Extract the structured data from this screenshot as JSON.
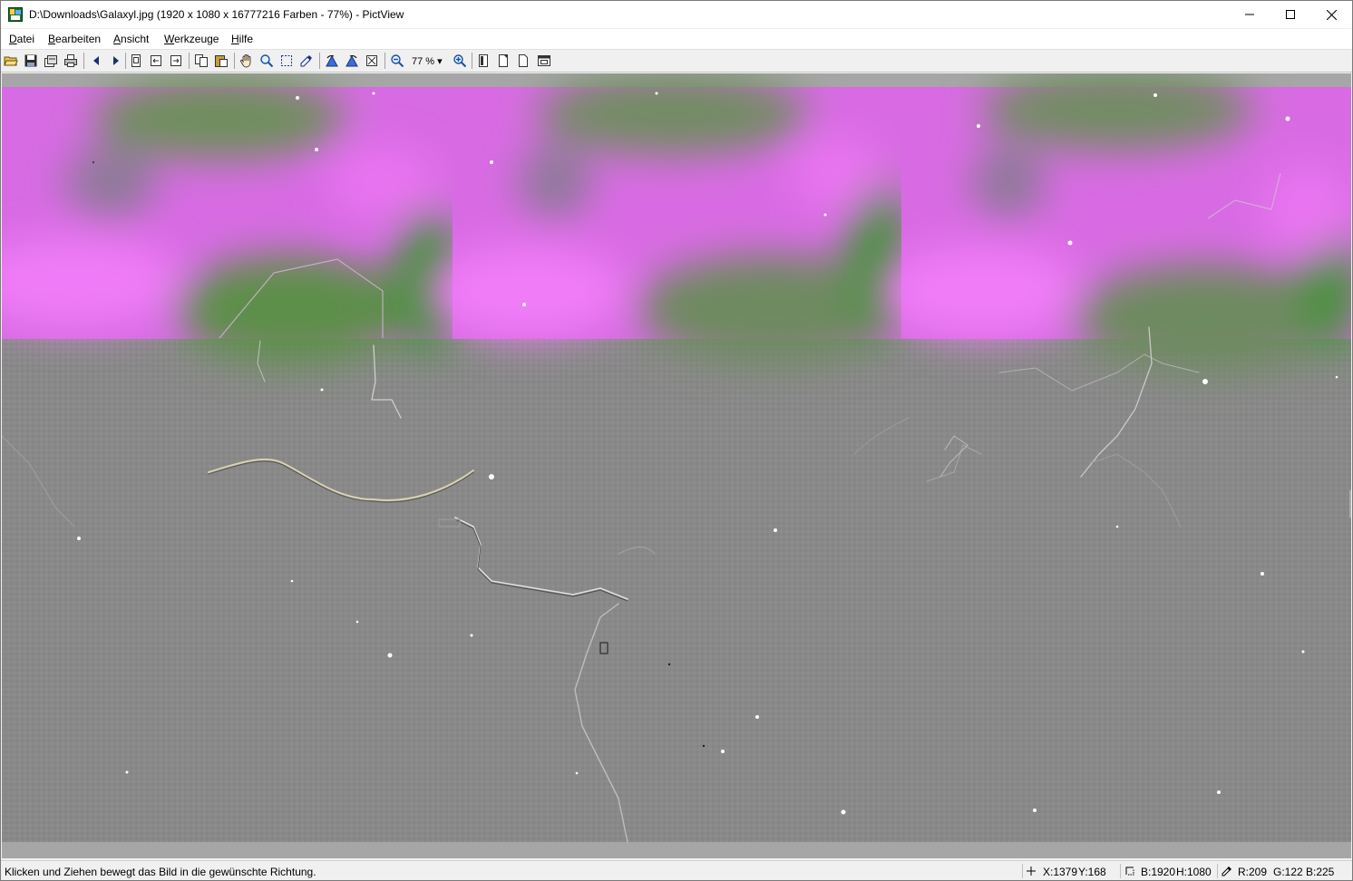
{
  "window": {
    "title": "D:\\Downloads\\Galaxyl.jpg (1920 x 1080 x 16777216 Farben - 77%) - PictView",
    "app_icon": "pictview-app-icon"
  },
  "title_controls": {
    "minimize_icon": "minimize-icon",
    "maximize_icon": "maximize-icon",
    "close_icon": "close-icon"
  },
  "menu": {
    "items": [
      {
        "id": "datei",
        "hotkey": "D",
        "rest": "atei"
      },
      {
        "id": "bearbeiten",
        "hotkey": "B",
        "rest": "earbeiten"
      },
      {
        "id": "ansicht",
        "hotkey": "A",
        "rest": "nsicht"
      },
      {
        "id": "werkzeuge",
        "hotkey": "W",
        "rest": "erkzeuge"
      },
      {
        "id": "hilfe",
        "hotkey": "H",
        "rest": "ilfe"
      }
    ]
  },
  "toolbar": {
    "zoom_label": "77 % ▾",
    "icons": [
      "open-folder-icon",
      "save-icon",
      "properties-icon",
      "print-icon",
      "previous-icon",
      "next-icon",
      "page-icon",
      "fit-icon",
      "fit-width-icon",
      "copy-icon",
      "paste-icon",
      "hand-icon",
      "magnifier-icon",
      "selection-icon",
      "eyedropper-icon",
      "rotate-left-icon",
      "rotate-right-icon",
      "transform-icon",
      "zoom-out-icon",
      "zoom-in-icon",
      "page-a-icon",
      "page-b-icon",
      "page-c-icon",
      "window-icon"
    ]
  },
  "status": {
    "message": "Klicken und Ziehen bewegt das Bild in die gewünschte Richtung.",
    "position_x": "X:1379",
    "position_y": "Y:168",
    "size_w": "B:1920",
    "size_h": "H:1080",
    "color_r": "R:209",
    "color_g": "G:122",
    "color_b": "B:225",
    "crosshair_icon": "crosshair-icon",
    "size_icon": "selection-size-icon",
    "picker_icon": "color-picker-icon"
  },
  "colors": {
    "magenta": "#e56ef0",
    "green": "#4f8f3e",
    "gray": "#8a8a8a"
  }
}
